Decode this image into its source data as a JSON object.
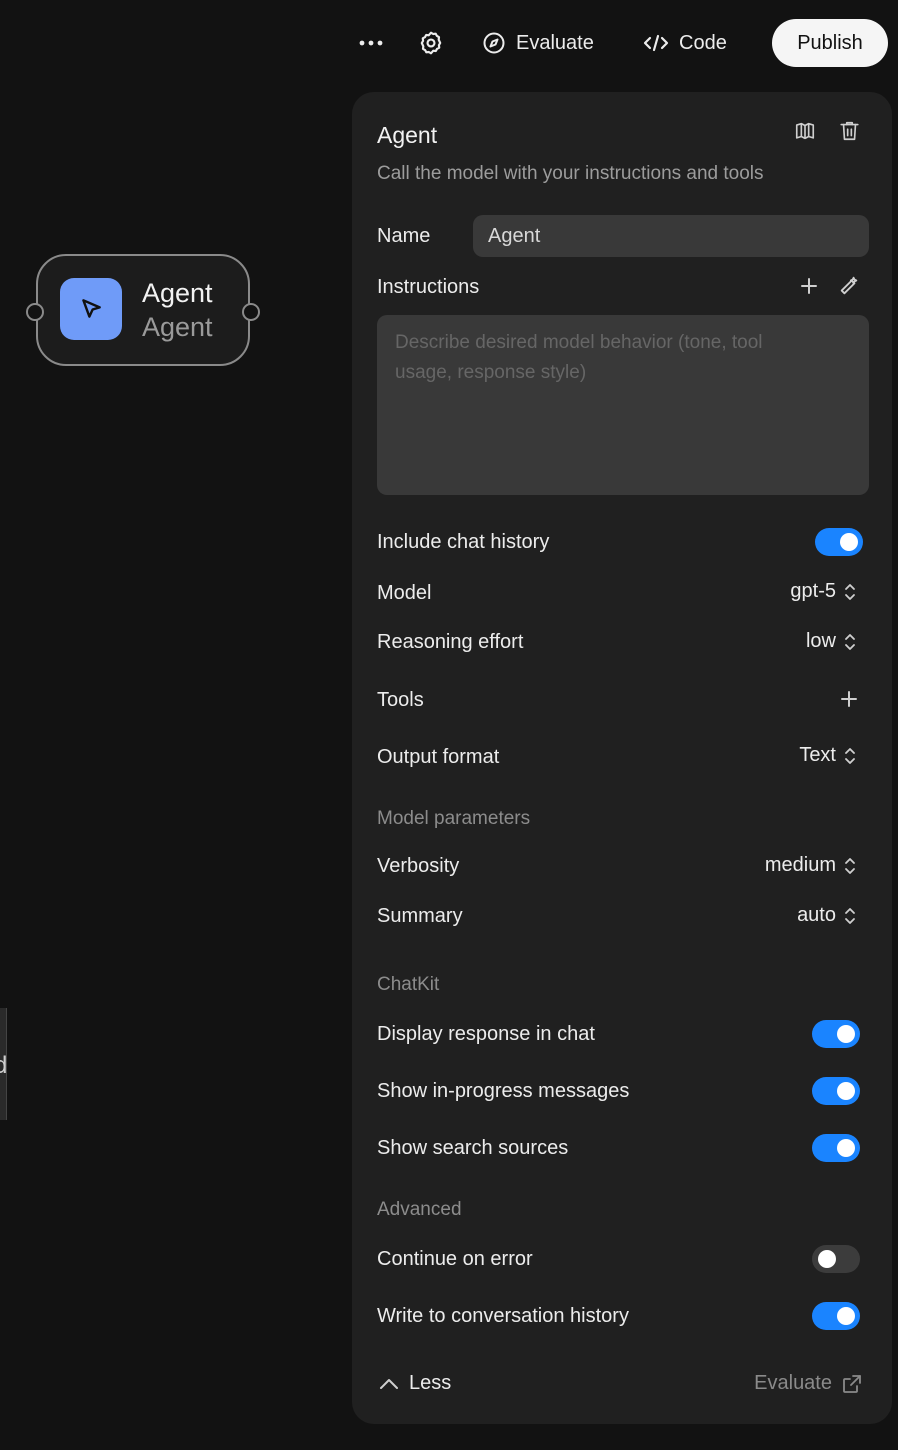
{
  "toolbar": {
    "evaluate_label": "Evaluate",
    "code_label": "Code",
    "publish_label": "Publish"
  },
  "node": {
    "title": "Agent",
    "subtitle": "Agent",
    "icon": "cursor-icon",
    "accent": "#6f9bf8"
  },
  "canvas": {
    "partial_text": "d"
  },
  "panel": {
    "title": "Agent",
    "description": "Call the model with your instructions and tools",
    "name_label": "Name",
    "name_value": "Agent",
    "instructions_label": "Instructions",
    "instructions_placeholder_line1": "Describe desired model behavior (tone, tool",
    "instructions_placeholder_line2": "usage, response style)",
    "include_chat_history": {
      "label": "Include chat history",
      "on": true
    },
    "model": {
      "label": "Model",
      "value": "gpt-5"
    },
    "reasoning_effort": {
      "label": "Reasoning effort",
      "value": "low"
    },
    "tools_label": "Tools",
    "output_format": {
      "label": "Output format",
      "value": "Text"
    },
    "model_parameters_heading": "Model parameters",
    "verbosity": {
      "label": "Verbosity",
      "value": "medium"
    },
    "summary": {
      "label": "Summary",
      "value": "auto"
    },
    "chatkit_heading": "ChatKit",
    "display_response": {
      "label": "Display response in chat",
      "on": true
    },
    "show_in_progress": {
      "label": "Show in-progress messages",
      "on": true
    },
    "show_search_sources": {
      "label": "Show search sources",
      "on": true
    },
    "advanced_heading": "Advanced",
    "continue_on_error": {
      "label": "Continue on error",
      "on": false
    },
    "write_history": {
      "label": "Write to conversation history",
      "on": true
    },
    "less_label": "Less",
    "evaluate_link": "Evaluate"
  },
  "colors": {
    "background": "#121212",
    "panel": "#202020",
    "toggle_on": "#1a84ff",
    "publish_bg": "#f5f5f5"
  }
}
